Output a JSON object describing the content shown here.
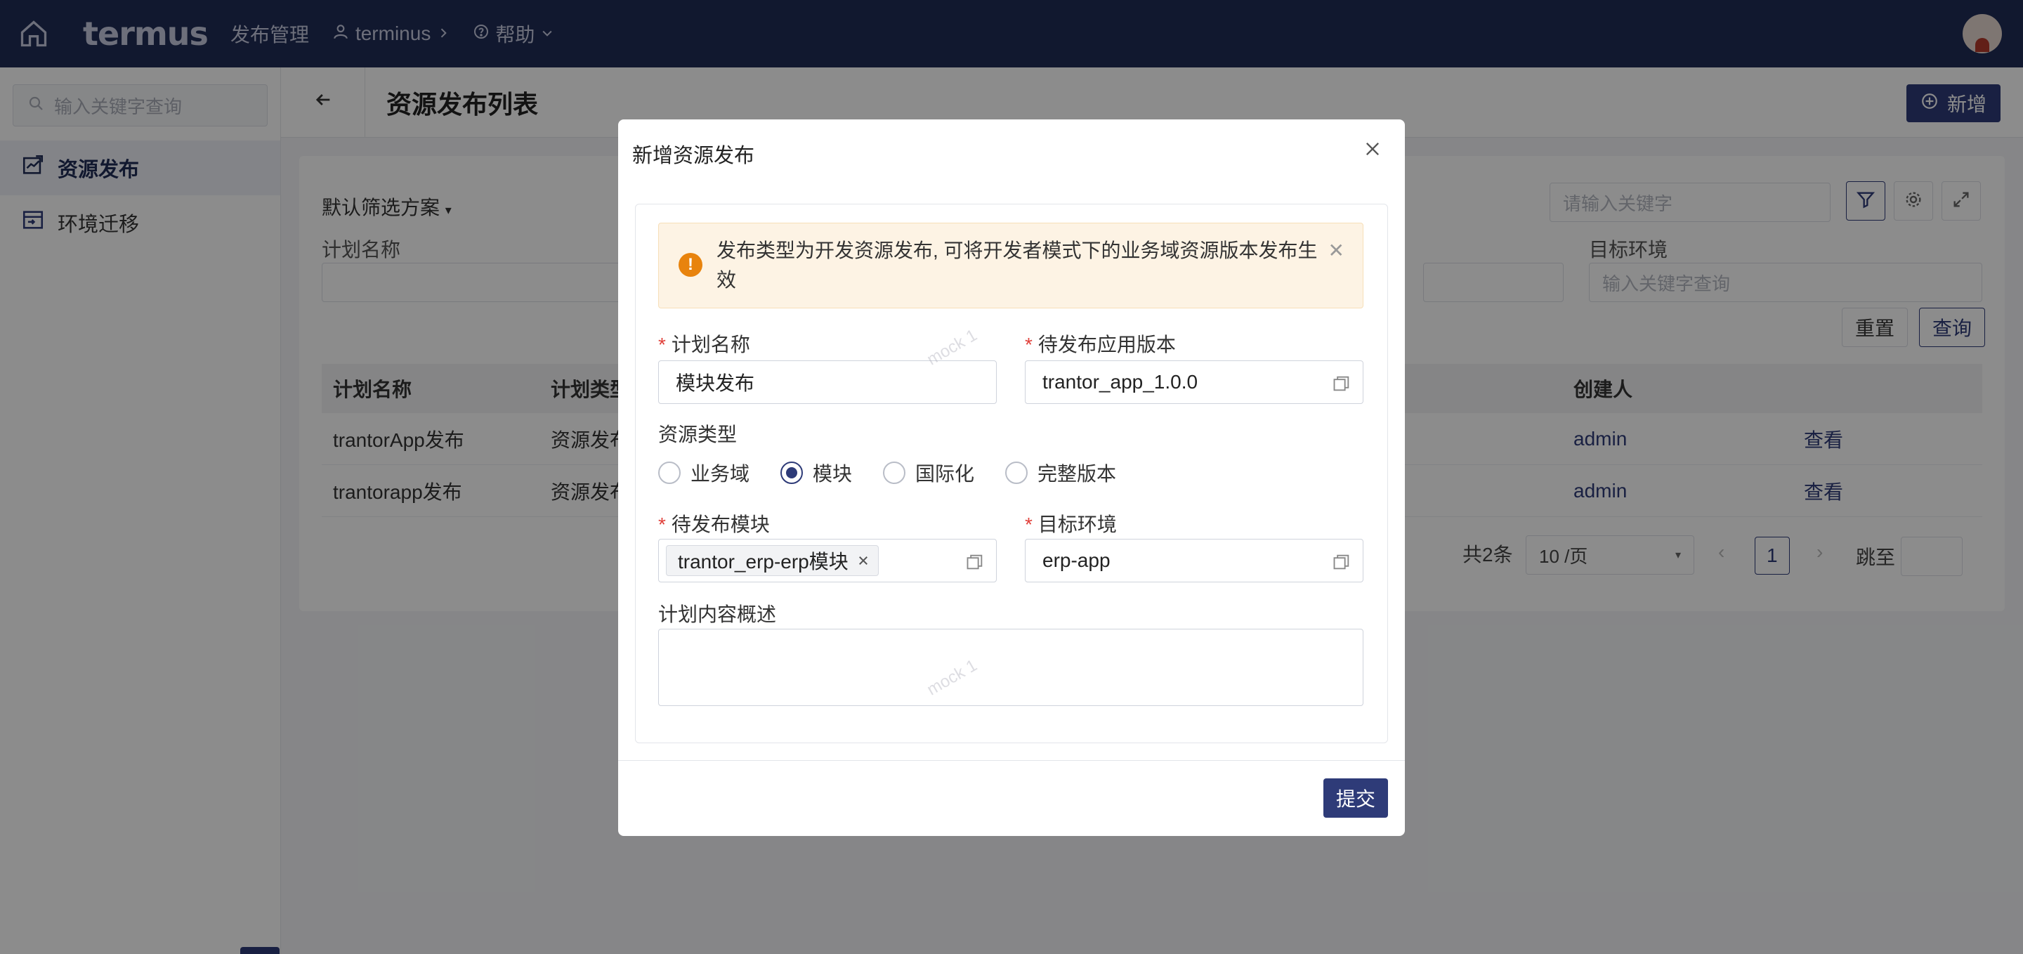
{
  "header": {
    "logo_text": "termus",
    "nav_release": "发布管理",
    "user_name": "terminus",
    "help_label": "帮助"
  },
  "sidebar": {
    "search_placeholder": "输入关键字查询",
    "items": [
      {
        "label": "资源发布",
        "active": true,
        "icon": "release-icon"
      },
      {
        "label": "环境迁移",
        "active": false,
        "icon": "migrate-icon"
      }
    ]
  },
  "page": {
    "title": "资源发布列表",
    "add_label": "新增"
  },
  "filters": {
    "scheme": "默认筛选方案",
    "plan_name_label": "计划名称",
    "target_env_label": "目标环境",
    "target_env_placeholder": "输入关键字查询",
    "search_placeholder": "请输入关键字",
    "reset_label": "重置",
    "query_label": "查询"
  },
  "table": {
    "columns": [
      "计划名称",
      "计划类型",
      "创建人"
    ],
    "rows": [
      {
        "name": "trantorApp发布",
        "type": "资源发布",
        "creator": "admin",
        "action": "查看"
      },
      {
        "name": "trantorapp发布",
        "type": "资源发布",
        "creator": "admin",
        "action": "查看"
      }
    ]
  },
  "pagination": {
    "total": "共2条",
    "page_size": "10 /页",
    "current_page": "1",
    "jump_label": "跳至"
  },
  "modal": {
    "title": "新增资源发布",
    "alert": "发布类型为开发资源发布, 可将开发者模式下的业务域资源版本发布生效",
    "plan_name_label": "计划名称",
    "plan_name_value": "模块发布",
    "app_version_label": "待发布应用版本",
    "app_version_value": "trantor_app_1.0.0",
    "resource_type_label": "资源类型",
    "resource_types": [
      {
        "label": "业务域",
        "checked": false
      },
      {
        "label": "模块",
        "checked": true
      },
      {
        "label": "国际化",
        "checked": false
      },
      {
        "label": "完整版本",
        "checked": false
      }
    ],
    "module_label": "待发布模块",
    "module_tag": "trantor_erp-erp模块",
    "target_env_label": "目标环境",
    "target_env_value": "erp-app",
    "summary_label": "计划内容概述",
    "summary_value": "",
    "submit_label": "提交"
  },
  "watermark": "mock 1",
  "colors": {
    "topbar": "#1f2c56",
    "primary": "#2e3b78",
    "required": "#e0403a",
    "warning": "#e8830d"
  }
}
